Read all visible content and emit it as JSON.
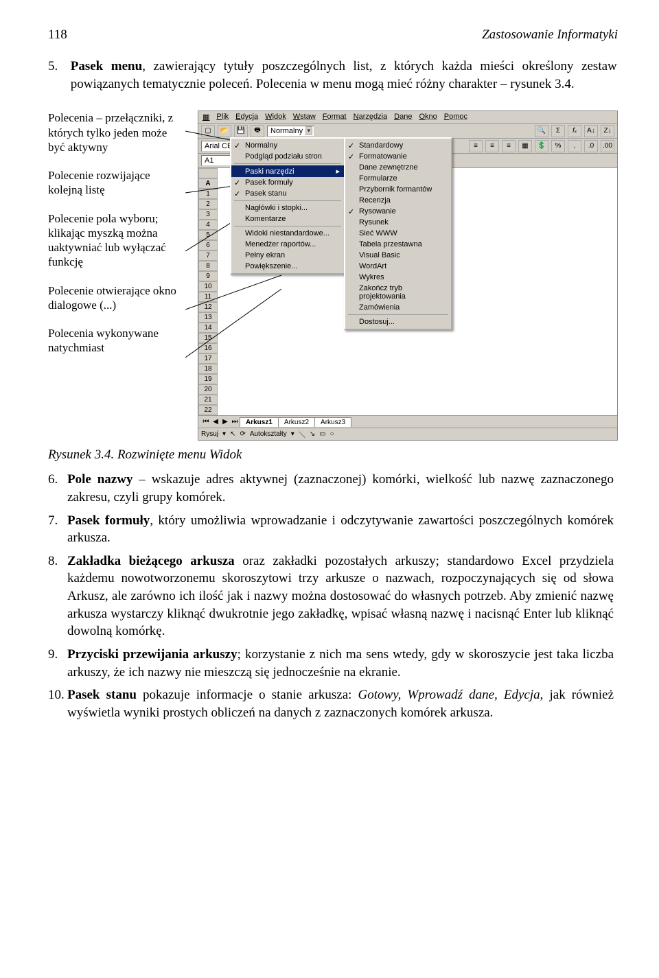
{
  "header": {
    "page_num": "118",
    "running_title": "Zastosowanie Informatyki"
  },
  "intro": {
    "num": "5.",
    "lead": "Pasek menu",
    "rest": ", zawierający tytuły poszczególnych list, z których każda mieści określony zestaw powiązanych tematycznie poleceń. Polecenia w menu mogą mieć różny charakter – rysunek 3.4."
  },
  "labels": {
    "l1": "Polecenia – przełączniki, z których tylko jeden może być aktywny",
    "l2": "Polecenie rozwijające kolejną listę",
    "l3": "Polecenie pola wyboru; klikając myszką można uaktywniać lub wyłączać funkcję",
    "l4": "Polecenie otwierające okno dialogowe (...)",
    "l5": "Polecenia wykonywane natychmiast"
  },
  "excel": {
    "menubar": [
      "Plik",
      "Edycja",
      "Widok",
      "Wstaw",
      "Format",
      "Narzędzia",
      "Dane",
      "Okno",
      "Pomoc"
    ],
    "style_dd": "Normalny",
    "row2_item": "Podgląd podziału stron",
    "font_dd": "Arial CE",
    "namebox": "A1",
    "colA": "A",
    "menu": {
      "items": [
        {
          "label": "Normalny",
          "check": true
        },
        {
          "label": "Podgląd podziału stron"
        },
        {
          "sep": true
        },
        {
          "label": "Paski narzędzi",
          "arrow": true,
          "sel": true
        },
        {
          "label": "Pasek formuły",
          "check": true
        },
        {
          "label": "Pasek stanu",
          "check": true
        },
        {
          "sep": true
        },
        {
          "label": "Nagłówki i stopki..."
        },
        {
          "label": "Komentarze"
        },
        {
          "sep": true
        },
        {
          "label": "Widoki niestandardowe..."
        },
        {
          "label": "Menedżer raportów..."
        },
        {
          "label": "Pełny ekran"
        },
        {
          "label": "Powiększenie..."
        }
      ]
    },
    "submenu": {
      "items": [
        {
          "label": "Standardowy",
          "check": true
        },
        {
          "label": "Formatowanie",
          "check": true
        },
        {
          "label": "Dane zewnętrzne"
        },
        {
          "label": "Formularze"
        },
        {
          "label": "Przybornik formantów"
        },
        {
          "label": "Recenzja"
        },
        {
          "label": "Rysowanie",
          "check": true
        },
        {
          "label": "Rysunek"
        },
        {
          "label": "Sieć WWW"
        },
        {
          "label": "Tabela przestawna"
        },
        {
          "label": "Visual Basic"
        },
        {
          "label": "WordArt"
        },
        {
          "label": "Wykres"
        },
        {
          "label": "Zakończ tryb projektowania"
        },
        {
          "label": "Zamówienia"
        },
        {
          "sep": true
        },
        {
          "label": "Dostosuj..."
        }
      ]
    },
    "sheets": [
      "Arkusz1",
      "Arkusz2",
      "Arkusz3"
    ],
    "drawbar": {
      "label": "Rysuj",
      "auto": "Autokształty"
    }
  },
  "caption": "Rysunek 3.4. Rozwinięte menu Widok",
  "items": [
    {
      "num": "6.",
      "lead": "Pole nazwy",
      "rest": " – wskazuje adres aktywnej (zaznaczonej) komórki, wielkość lub nazwę zaznaczonego zakresu, czyli grupy komórek."
    },
    {
      "num": "7.",
      "lead": "Pasek formuły",
      "rest": ", który umożliwia wprowadzanie i odczytywanie zawartości poszczególnych komórek arkusza."
    },
    {
      "num": "8.",
      "lead": "Zakładka bieżącego arkusza",
      "rest": " oraz zakładki pozostałych arkuszy; standardowo Excel przydziela każdemu nowotworzonemu skoroszytowi trzy arkusze o nazwach, rozpoczynających się od słowa Arkusz, ale zarówno ich ilość jak i nazwy można dostosować do własnych potrzeb. Aby zmienić nazwę arkusza wystarczy kliknąć dwukrotnie jego zakładkę, wpisać własną nazwę i nacisnąć Enter lub kliknąć dowolną komórkę."
    },
    {
      "num": "9.",
      "lead": "Przyciski przewijania arkuszy",
      "rest": "; korzystanie z nich ma sens wtedy, gdy w skoroszycie jest taka liczba arkuszy, że ich nazwy nie mieszczą się jednocześnie na ekranie."
    },
    {
      "num": "10.",
      "lead": "Pasek stanu",
      "rest": " pokazuje informacje o stanie arkusza: ",
      "ital": "Gotowy, Wprowadź dane, Edycja",
      "rest2": ", jak również wyświetla wyniki prostych obliczeń na danych z zaznaczonych komórek arkusza."
    }
  ]
}
